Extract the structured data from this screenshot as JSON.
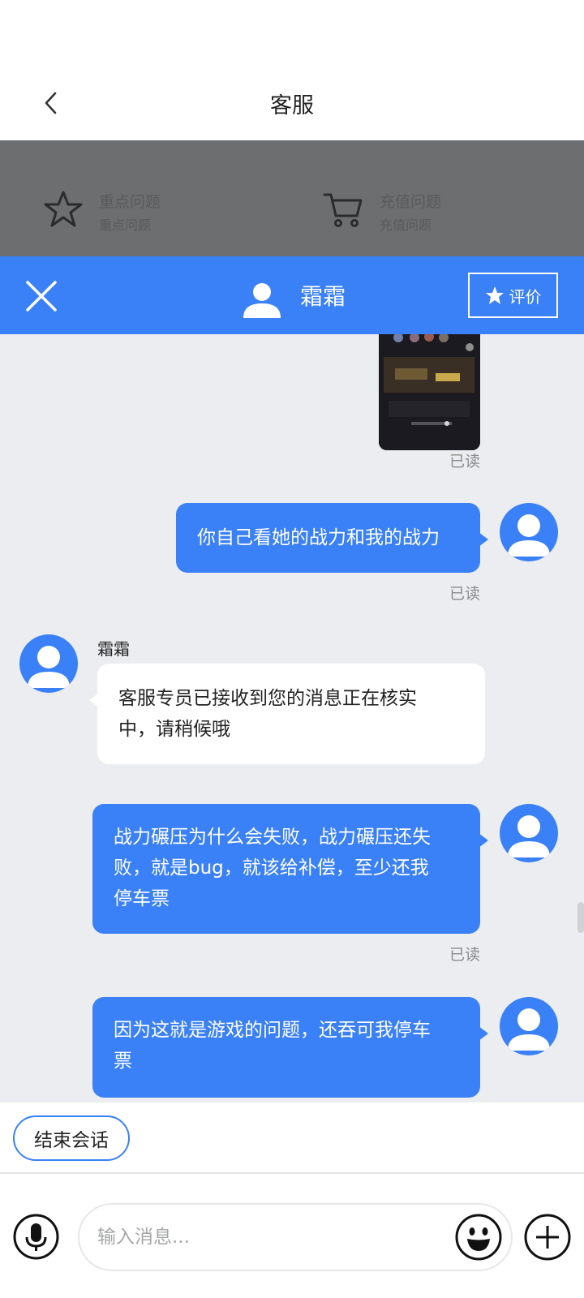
{
  "header": {
    "title": "客服"
  },
  "faq": [
    {
      "title": "重点问题",
      "subtitle": "重点问题",
      "icon": "star-outline-icon"
    },
    {
      "title": "充值问题",
      "subtitle": "充值问题",
      "icon": "cart-icon"
    }
  ],
  "chat_header": {
    "agent_name": "霜霜",
    "rate_label": "评价"
  },
  "messages": {
    "read_label": "已读",
    "agent_name": "霜霜",
    "m1": "你自己看她的战力和我的战力",
    "m2_line1": "客服专员已接收到您的消息正在核实",
    "m2_line2": "中，请稍候哦",
    "m3_line1": "战力碾压为什么会失败，战力碾压还失",
    "m3_line2": "败，就是bug，就该给补偿，至少还我",
    "m3_line3": "停车票",
    "m4_line1": "因为这就是游戏的问题，还吞可我停车",
    "m4_line2": "票"
  },
  "actions": {
    "end_label": "结束会话"
  },
  "input": {
    "placeholder": "输入消息..."
  },
  "colors": {
    "accent": "#3a80f6",
    "chat_bg": "#ecedf0",
    "overlay": "#6d6e70"
  }
}
